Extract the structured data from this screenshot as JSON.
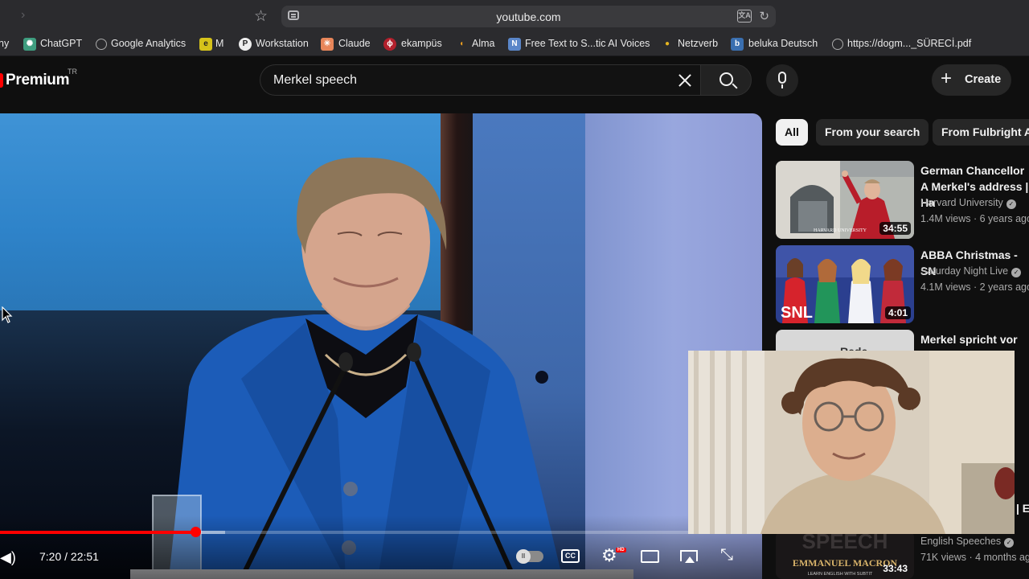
{
  "browser": {
    "url": "youtube.com"
  },
  "bookmarks": [
    {
      "label": "ny",
      "icon": "clipped"
    },
    {
      "label": "ChatGPT",
      "icon": "chatgpt-icon"
    },
    {
      "label": "Google Analytics",
      "icon": "globe-icon"
    },
    {
      "label": "M",
      "icon": "m-icon"
    },
    {
      "label": "Workstation",
      "icon": "workstation-icon"
    },
    {
      "label": "Claude",
      "icon": "claude-icon"
    },
    {
      "label": "ekampüs",
      "icon": "ekampus-icon"
    },
    {
      "label": "Alma",
      "icon": "alma-icon"
    },
    {
      "label": "Free Text to S...tic AI Voices",
      "icon": "n-icon"
    },
    {
      "label": "Netzverb",
      "icon": "netzverb-icon"
    },
    {
      "label": "beluka Deutsch",
      "icon": "beluka-icon"
    },
    {
      "label": "https://dogm..._SÜRECİ.pdf",
      "icon": "globe-icon"
    }
  ],
  "header": {
    "logo": "Premium",
    "logo_region": "TR",
    "search_query": "Merkel speech",
    "create_label": "Create"
  },
  "player": {
    "current_time": "7:20",
    "duration": "22:51",
    "time_display": "7:20 / 22:51",
    "progress_fraction": 0.321,
    "buffered_fraction": 0.3,
    "cc_label": "CC",
    "hd_badge": "HD"
  },
  "chips": [
    {
      "label": "All",
      "active": true
    },
    {
      "label": "From your search",
      "active": false
    },
    {
      "label": "From Fulbright A",
      "active": false
    }
  ],
  "related": [
    {
      "title": "German Chancellor A Merkel's address | Ha",
      "channel": "Harvard University",
      "verified": true,
      "meta": "1.4M views · 6 years ago",
      "duration": "34:55",
      "thumb_caption": "HARVARD UNIVERSITY"
    },
    {
      "title": "ABBA Christmas - SN",
      "channel": "Saturday Night Live",
      "verified": true,
      "meta": "4.1M views · 2 years ago",
      "duration": "4:01",
      "thumb_caption": "SNL"
    },
    {
      "title": "Merkel spricht vor Ha",
      "channel": "",
      "verified": false,
      "meta": "",
      "duration": "",
      "thumb_caption": "Rede"
    },
    {
      "title": "| E",
      "channel": "English Speeches",
      "verified": true,
      "meta": "71K views · 4 months ag",
      "duration": "33:43",
      "thumb_caption": "EMMANUEL MACRON",
      "thumb_subcaption": "LEARN ENGLISH WITH SUBTIT",
      "thumb_bg_text": "SPEECH"
    }
  ],
  "colors": {
    "accent": "#ff0000",
    "background": "#0f0f0f",
    "chip_bg": "#272727"
  }
}
